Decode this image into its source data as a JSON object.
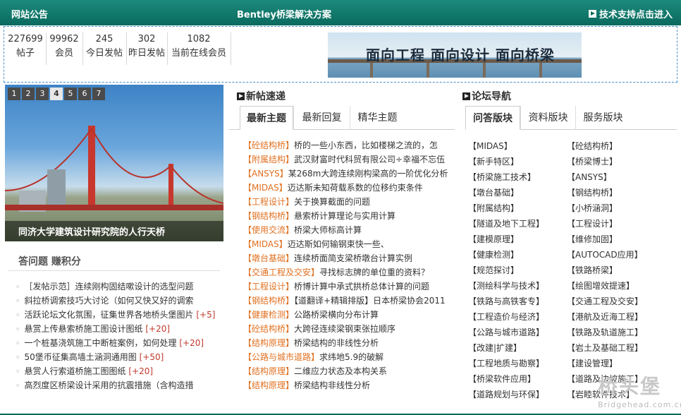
{
  "header": {
    "notice": "网站公告",
    "title": "Bentley桥梁解决方案",
    "support": "技术支持点击进入"
  },
  "stats": [
    {
      "num": "227699",
      "label": "帖子"
    },
    {
      "num": "99962",
      "label": "会员"
    },
    {
      "num": "245",
      "label": "今日发帖"
    },
    {
      "num": "302",
      "label": "昨日发帖"
    },
    {
      "num": "1082",
      "label": "当前在线会员"
    }
  ],
  "banner": {
    "text": "面向工程 面向设计 面向桥梁"
  },
  "slideshow": {
    "pages": [
      "1",
      "2",
      "3",
      "4",
      "5",
      "6",
      "7"
    ],
    "active": "4",
    "caption": "同济大学建筑设计研究院的人行天桥"
  },
  "qa": {
    "heading": "答问题 赚积分",
    "items": [
      {
        "text": "［发帖示范］连续刚构固结嗽设计的选型问题",
        "bonus": ""
      },
      {
        "text": "斜拉桥调索技巧大讨论（如何又快又好的调索",
        "bonus": ""
      },
      {
        "text": "活跃论坛文化氛围，征集世界各地桥头堡图片 ",
        "bonus": "[+5]"
      },
      {
        "text": "悬赏上传悬索桥施工图设计图纸 ",
        "bonus": "[+20]"
      },
      {
        "text": "一个桩基浇筑施工中断桩案例，如何处理 ",
        "bonus": "[+20]"
      },
      {
        "text": "50堡币征集高墙土涵洞通用图 ",
        "bonus": "[+50]"
      },
      {
        "text": "悬赏人行索道桥施工图图纸 ",
        "bonus": "[+20]"
      },
      {
        "text": "高烈度区桥梁设计采用的抗震措施（含构造措",
        "bonus": ""
      }
    ]
  },
  "new_posts": {
    "heading": "新帖速递",
    "tabs": [
      "最新主题",
      "最新回复",
      "精华主题"
    ],
    "active_tab": "最新主题",
    "items": [
      {
        "cat": "【砼结构桥】",
        "title": "桥的一些小东西，比如楼梯之流的，怎"
      },
      {
        "cat": "【附属结构】",
        "title": "武汉财富时代科贸有限公司÷幸福不忘伍"
      },
      {
        "cat": "【ANSYS】",
        "title": "某268m大跨连续刚构梁高的一阶优化分析"
      },
      {
        "cat": "【MIDAS】",
        "title": "迈达斯未知荷载系数的位移约束条件"
      },
      {
        "cat": "【工程设计】",
        "title": "关于换算截面的问题"
      },
      {
        "cat": "【钢结构桥】",
        "title": "悬索桥计算理论与实用计算"
      },
      {
        "cat": "【使用交流】",
        "title": "桥梁大师标高计算"
      },
      {
        "cat": "【MIDAS】",
        "title": "迈达斯如何输钢束快一些、"
      },
      {
        "cat": "【墩台基础】",
        "title": "连续桥面简支梁桥墩台计算实例"
      },
      {
        "cat": "【交通工程及交安】",
        "title": "寻找标志牌的单位重的资料？"
      },
      {
        "cat": "【工程设计】",
        "title": "桥博计算中承式拱桥总体计算的问题"
      },
      {
        "cat": "【钢结构桥】",
        "title": "【道翻译+精辑排版】日本桥梁协会2011"
      },
      {
        "cat": "【健康检测】",
        "title": "公路桥梁横向分布计算"
      },
      {
        "cat": "【砼结构桥】",
        "title": "大跨径连续梁钢束张拉顺序"
      },
      {
        "cat": "【结构原理】",
        "title": "桥梁结构的非线性分析"
      },
      {
        "cat": "【公路与城市道路】",
        "title": "求纬地5.9的破解"
      },
      {
        "cat": "【结构原理】",
        "title": "二维应力状态及本构关系"
      },
      {
        "cat": "【结构原理】",
        "title": "桥梁结构非线性分析"
      }
    ]
  },
  "forum_nav": {
    "heading": "论坛导航",
    "tabs": [
      "问答版块",
      "资料版块",
      "服务版块"
    ],
    "active_tab": "问答版块",
    "col1": [
      "【MIDAS】",
      "【新手特区】",
      "【桥梁施工技术】",
      "【墩台基础】",
      "【附属结构】",
      "【隧道及地下工程】",
      "【建模原理】",
      "【健康检测】",
      "【规范探讨】",
      "【测绘科学与技术】",
      "【铁路与高铁客专】",
      "【工程造价与经济】",
      "【公路与城市道路】",
      "【改建|扩建】",
      "【工程地质与勘察】",
      "【桥梁软件应用】",
      "【道路规划与环保】"
    ],
    "col2": [
      "【砼结构桥】",
      "【桥梁博士】",
      "【ANSYS】",
      "【钢结构桥】",
      "【小桥涵洞】",
      "【工程设计】",
      "【维修加固】",
      "【AUTOCAD应用】",
      "【铁路桥梁】",
      "【绘图增效提速】",
      "【交通工程及交安】",
      "【港航及近海工程】",
      "【铁路及轨道施工】",
      "【岩土及基础工程】",
      "【建设管理】",
      "【道路及边坡施工】",
      "【岩睦软件技术】"
    ]
  },
  "watermark": {
    "logo": "桥头堡",
    "url": "Bridgehead.com.cn"
  },
  "colors": {
    "header_bg": "#0a6a5e",
    "category": "#e07020",
    "bonus": "#c0392b"
  }
}
